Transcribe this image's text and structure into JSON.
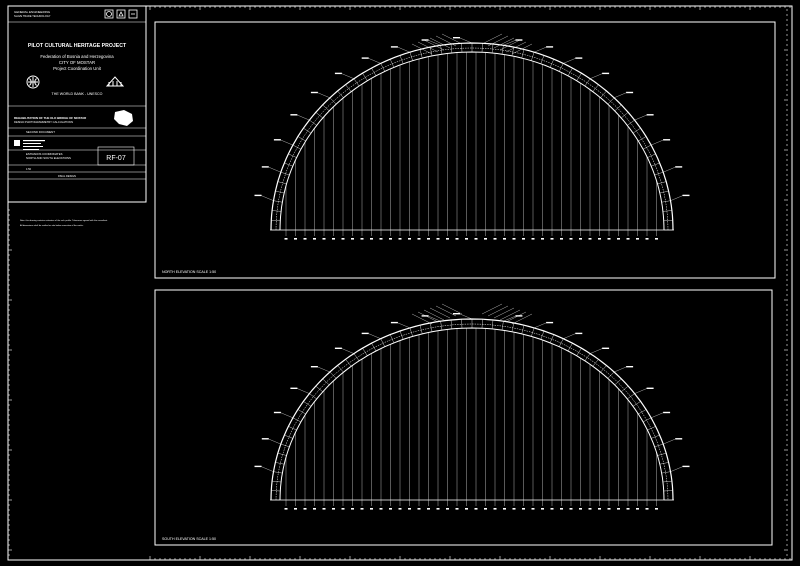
{
  "header": {
    "org_line1": "GENERAL ENGINEERING",
    "org_line2": "SLAVE TRADE TECHNOLOGY"
  },
  "title_block": {
    "project": "PILOT CULTURAL HERITAGE PROJECT",
    "federation": "Federation of Bosnia and Herzegovina",
    "city": "CITY OF MOSTAR",
    "unit": "Project Coordination Unit",
    "sponsors": "THE WORLD BANK - UNESCO",
    "subject_line1": "REHABILITATION OF THE OLD BRIDGE OF MOSTAR",
    "subject_line2": "DESIGN PHOTOGRAMMETRY CALCULATIONS",
    "document": "SECOND DOCUMENT",
    "sheet_title_line1": "ESTRADOS COORDINATES",
    "sheet_title_line2": "NORTH AND SOUTH ELEVATIONS",
    "sheet_code": "RF-07",
    "scale_value": "1:50",
    "phase": "FINAL DESIGN",
    "note_line1": "Note: this drawing contains estimates of the arch profile. Tolerances agreed with the consultant.",
    "note_line2": "All dimensions shall be verified on site before execution of the works."
  },
  "panels": {
    "north_label": "NORTH ELEVATION   SCALE 1:50",
    "south_label": "SOUTH ELEVATION   SCALE 1:50"
  },
  "colors": {
    "background": "#000000",
    "lines": "#ffffff"
  }
}
